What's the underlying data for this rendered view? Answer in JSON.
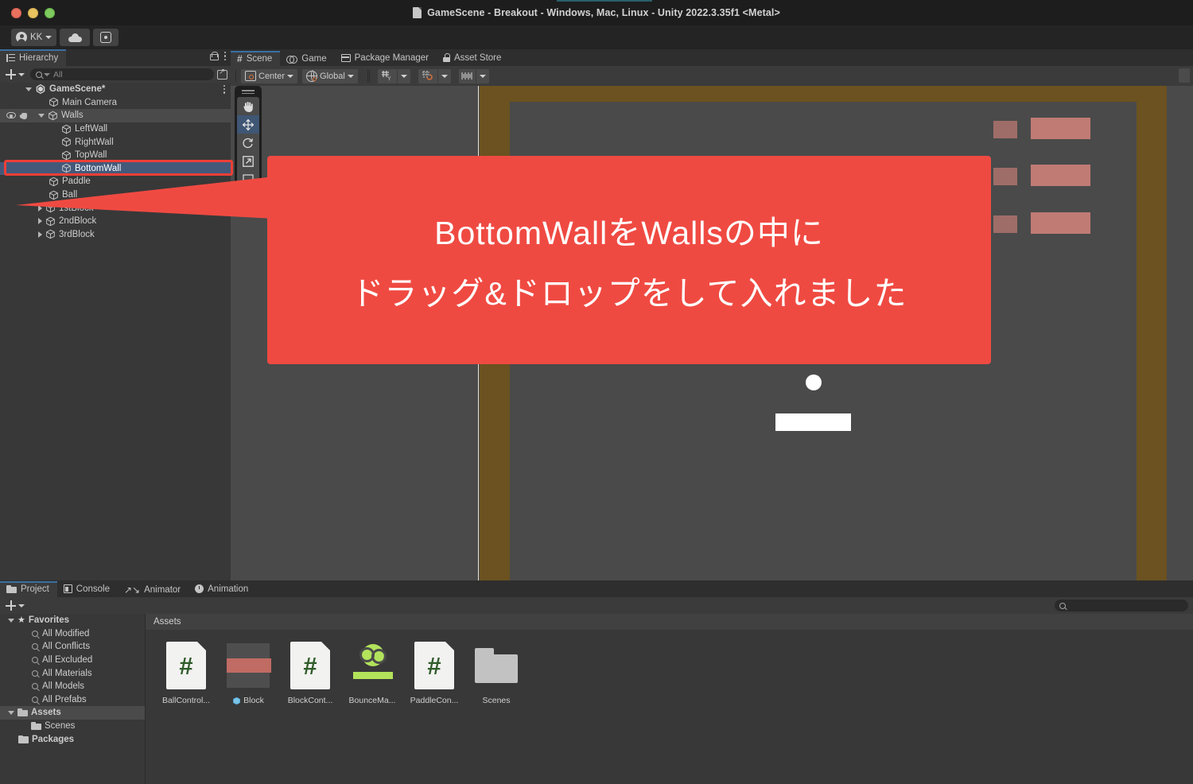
{
  "window": {
    "title": "GameScene - Breakout - Windows, Mac, Linux - Unity 2022.3.35f1 <Metal>",
    "doc_icon": "document-icon",
    "traffic": [
      "close-button",
      "minimize-button",
      "maximize-button"
    ]
  },
  "app_toolbar": {
    "account_label": "KK",
    "account_icon": "account-icon",
    "cloud_icon": "cloud-icon",
    "services_icon": "gear-icon",
    "play_icon": "play-icon",
    "pause_icon": "pause-icon",
    "step_icon": "step-icon"
  },
  "hierarchy": {
    "tab_label": "Hierarchy",
    "tab_icon": "hierarchy-icon",
    "lock_icon": "lock-icon",
    "menu_icon": "kebab-menu-icon",
    "add_label": "+",
    "search_placeholder": "All",
    "search_value": "",
    "search_icon": "search-icon",
    "expand_icon": "expand-icon",
    "rows": [
      {
        "label": "GameScene*",
        "depth": 0,
        "icon": "unity-scene-icon",
        "fold": "down",
        "state": "normal",
        "bold": true,
        "kebab": true
      },
      {
        "label": "Main Camera",
        "depth": 1,
        "icon": "gameobject-cube-icon",
        "fold": "none",
        "state": "normal"
      },
      {
        "label": "Walls",
        "depth": 1,
        "icon": "gameobject-cube-icon",
        "fold": "down",
        "state": "hover",
        "vis": true
      },
      {
        "label": "LeftWall",
        "depth": 2,
        "icon": "gameobject-cube-icon",
        "fold": "none",
        "state": "normal"
      },
      {
        "label": "RightWall",
        "depth": 2,
        "icon": "gameobject-cube-icon",
        "fold": "none",
        "state": "normal"
      },
      {
        "label": "TopWall",
        "depth": 2,
        "icon": "gameobject-cube-icon",
        "fold": "none",
        "state": "normal"
      },
      {
        "label": "BottomWall",
        "depth": 2,
        "icon": "gameobject-cube-icon",
        "fold": "none",
        "state": "selected"
      },
      {
        "label": "Paddle",
        "depth": 1,
        "icon": "gameobject-cube-icon",
        "fold": "none",
        "state": "normal"
      },
      {
        "label": "Ball",
        "depth": 1,
        "icon": "gameobject-cube-icon",
        "fold": "none",
        "state": "normal"
      },
      {
        "label": "1stBlock",
        "depth": 1,
        "icon": "gameobject-cube-icon",
        "fold": "right",
        "state": "normal"
      },
      {
        "label": "2ndBlock",
        "depth": 1,
        "icon": "gameobject-cube-icon",
        "fold": "right",
        "state": "normal"
      },
      {
        "label": "3rdBlock",
        "depth": 1,
        "icon": "gameobject-cube-icon",
        "fold": "right",
        "state": "normal"
      }
    ]
  },
  "center": {
    "tabs": [
      {
        "label": "Scene",
        "icon": "grid-hash-icon",
        "active": true
      },
      {
        "label": "Game",
        "icon": "gamepad-icon",
        "active": false
      },
      {
        "label": "Package Manager",
        "icon": "package-icon",
        "active": false
      },
      {
        "label": "Asset Store",
        "icon": "store-bag-icon",
        "active": false
      }
    ],
    "scene_toolbar": {
      "pivot_label": "Center",
      "pivot_icon": "pivot-icon",
      "space_label": "Global",
      "space_icon": "globe-icon",
      "grid_icon": "grid-visibility-icon",
      "snap_icon": "grid-snap-icon",
      "scale_icon": "grid-scale-icon",
      "dropdown_icon": "chevron-down-icon"
    },
    "tools": [
      {
        "name": "view-hand-tool",
        "selected": false
      },
      {
        "name": "move-tool",
        "selected": true
      },
      {
        "name": "rotate-tool",
        "selected": false
      },
      {
        "name": "scale-tool",
        "selected": false
      },
      {
        "name": "rect-tool",
        "selected": false
      },
      {
        "name": "transform-tool",
        "selected": false
      }
    ],
    "scene_objects": {
      "camera_gizmo": "camera-gizmo-icon",
      "x_axis_handle": "x-axis-arrow-handle",
      "ball": "ball-object",
      "paddle": "paddle-object",
      "walls": [
        "left-wall",
        "right-wall",
        "top-wall",
        "bottom-wall"
      ],
      "blocks_rows": 3,
      "blocks_per_row": 2
    }
  },
  "callout": {
    "line1": "BottomWallをWallsの中に",
    "line2": "ドラッグ&ドロップをして入れました",
    "color": "#ef4a42"
  },
  "project": {
    "tabs": [
      {
        "label": "Project",
        "icon": "folder-icon",
        "active": true
      },
      {
        "label": "Console",
        "icon": "console-icon",
        "active": false
      },
      {
        "label": "Animator",
        "icon": "animator-icon",
        "active": false
      },
      {
        "label": "Animation",
        "icon": "clock-icon",
        "active": false
      }
    ],
    "add_label": "+",
    "search_placeholder": "",
    "search_icon": "search-icon",
    "tree": [
      {
        "label": "Favorites",
        "icon": "star-icon",
        "fold": "down",
        "depth": 0,
        "bold": true
      },
      {
        "label": "All Modified",
        "icon": "search-icon",
        "fold": "none",
        "depth": 1
      },
      {
        "label": "All Conflicts",
        "icon": "search-icon",
        "fold": "none",
        "depth": 1
      },
      {
        "label": "All Excluded",
        "icon": "search-icon",
        "fold": "none",
        "depth": 1
      },
      {
        "label": "All Materials",
        "icon": "search-icon",
        "fold": "none",
        "depth": 1
      },
      {
        "label": "All Models",
        "icon": "search-icon",
        "fold": "none",
        "depth": 1
      },
      {
        "label": "All Prefabs",
        "icon": "search-icon",
        "fold": "none",
        "depth": 1
      },
      {
        "label": "Assets",
        "icon": "folder-open-icon",
        "fold": "down",
        "depth": 0,
        "bold": true,
        "selected": true
      },
      {
        "label": "Scenes",
        "icon": "folder-icon",
        "fold": "none",
        "depth": 1
      },
      {
        "label": "Packages",
        "icon": "folder-icon",
        "fold": "none",
        "depth": 0,
        "bold": true
      }
    ],
    "breadcrumb": "Assets",
    "assets": [
      {
        "label": "BallControl...",
        "kind": "csharp-script"
      },
      {
        "label": "Block",
        "kind": "material",
        "badge": "prefab-cube-icon"
      },
      {
        "label": "BlockCont...",
        "kind": "csharp-script"
      },
      {
        "label": "BounceMa...",
        "kind": "physics-material"
      },
      {
        "label": "PaddleCon...",
        "kind": "csharp-script"
      },
      {
        "label": "Scenes",
        "kind": "folder"
      }
    ]
  }
}
